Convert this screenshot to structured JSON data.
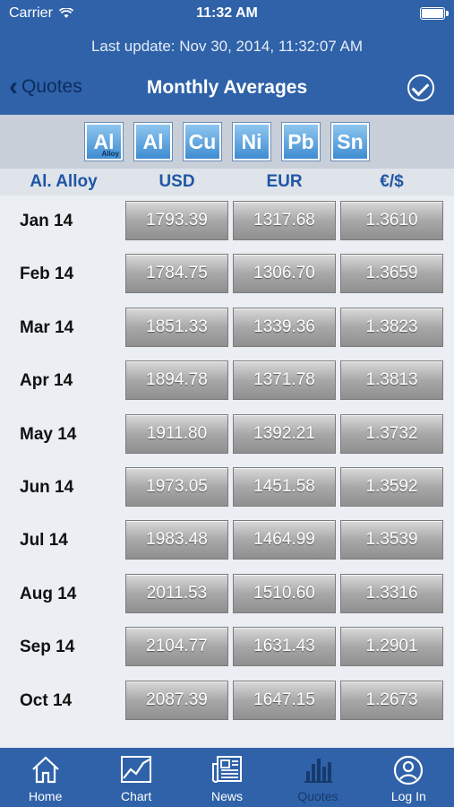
{
  "status": {
    "carrier": "Carrier",
    "time": "11:32 AM"
  },
  "header": {
    "last_update": "Last update: Nov 30, 2014, 11:32:07 AM",
    "back_label": "Quotes",
    "title": "Monthly Averages"
  },
  "metals": [
    {
      "symbol": "Al",
      "sub": "Alloy"
    },
    {
      "symbol": "Al",
      "sub": ""
    },
    {
      "symbol": "Cu",
      "sub": ""
    },
    {
      "symbol": "Ni",
      "sub": ""
    },
    {
      "symbol": "Pb",
      "sub": ""
    },
    {
      "symbol": "Sn",
      "sub": ""
    }
  ],
  "columns": {
    "label": "Al. Alloy",
    "usd": "USD",
    "eur": "EUR",
    "rate": "€/$"
  },
  "rows": [
    {
      "month": "Jan 14",
      "usd": "1793.39",
      "eur": "1317.68",
      "rate": "1.3610"
    },
    {
      "month": "Feb 14",
      "usd": "1784.75",
      "eur": "1306.70",
      "rate": "1.3659"
    },
    {
      "month": "Mar 14",
      "usd": "1851.33",
      "eur": "1339.36",
      "rate": "1.3823"
    },
    {
      "month": "Apr 14",
      "usd": "1894.78",
      "eur": "1371.78",
      "rate": "1.3813"
    },
    {
      "month": "May 14",
      "usd": "1911.80",
      "eur": "1392.21",
      "rate": "1.3732"
    },
    {
      "month": "Jun 14",
      "usd": "1973.05",
      "eur": "1451.58",
      "rate": "1.3592"
    },
    {
      "month": "Jul 14",
      "usd": "1983.48",
      "eur": "1464.99",
      "rate": "1.3539"
    },
    {
      "month": "Aug 14",
      "usd": "2011.53",
      "eur": "1510.60",
      "rate": "1.3316"
    },
    {
      "month": "Sep 14",
      "usd": "2104.77",
      "eur": "1631.43",
      "rate": "1.2901"
    },
    {
      "month": "Oct 14",
      "usd": "2087.39",
      "eur": "1647.15",
      "rate": "1.2673"
    }
  ],
  "tabs": [
    {
      "label": "Home",
      "icon": "home-icon"
    },
    {
      "label": "Chart",
      "icon": "chart-icon"
    },
    {
      "label": "News",
      "icon": "news-icon"
    },
    {
      "label": "Quotes",
      "icon": "quotes-icon",
      "active": true
    },
    {
      "label": "Log In",
      "icon": "login-icon"
    }
  ],
  "colors": {
    "bar": "#2f62a8",
    "accent": "#1f56a5",
    "active_tab": "#173a6e"
  }
}
